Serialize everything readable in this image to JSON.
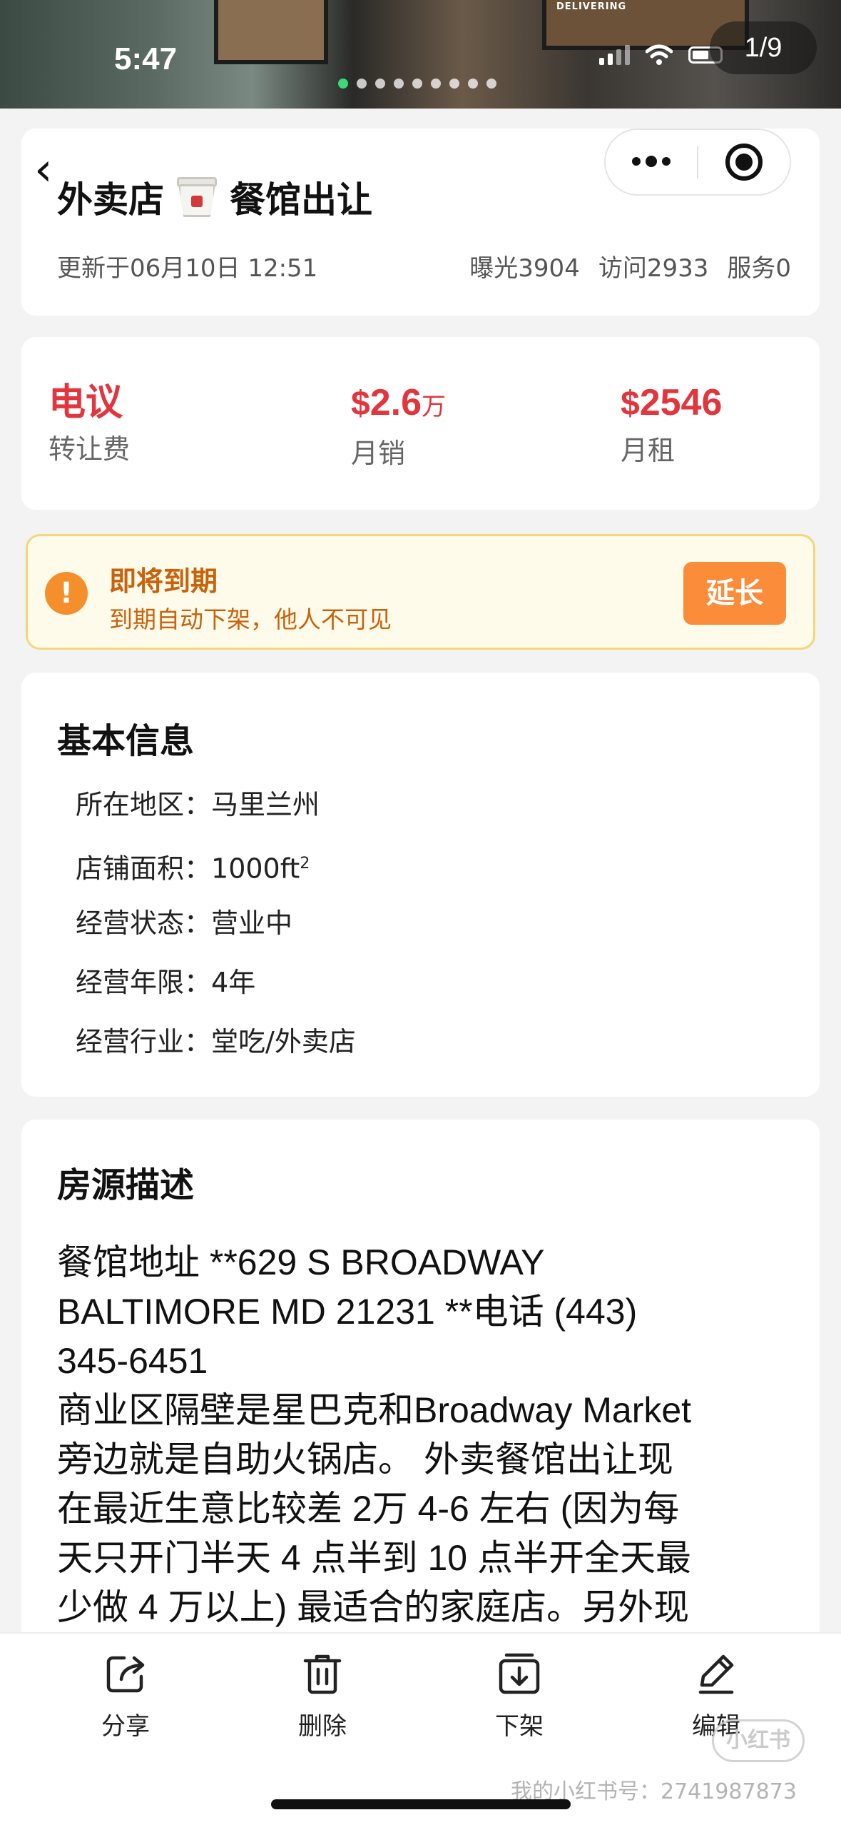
{
  "status_bar": {
    "time": "5:47"
  },
  "gallery": {
    "indicator": "1/9",
    "photo_text": "DELIVERING",
    "dots_total": 9,
    "active_dot": 0
  },
  "header": {
    "title_left": "外卖店",
    "title_right": "餐馆出让",
    "updated": "更新于06月10日 12:51",
    "stats": [
      "曝光3904",
      "访问2933",
      "服务0"
    ]
  },
  "prices": [
    {
      "value": "电议",
      "currency": "",
      "unit": "",
      "label": "转让费"
    },
    {
      "value": "2.6",
      "currency": "$",
      "unit": "万",
      "label": "月销"
    },
    {
      "value": "2546",
      "currency": "$",
      "unit": "",
      "label": "月租"
    }
  ],
  "expiry": {
    "icon": "!",
    "title": "即将到期",
    "subtitle": "到期自动下架，他人不可见",
    "button": "延长"
  },
  "basic_info": {
    "title": "基本信息",
    "rows": [
      {
        "label": "所在地区：",
        "value": "马里兰州"
      },
      {
        "label": "店铺面积：",
        "value": "1000ft",
        "sup": "2"
      },
      {
        "label": "经营状态：",
        "value": "营业中"
      },
      {
        "label": "经营年限：",
        "value": "4年"
      },
      {
        "label": "经营行业：",
        "value": "堂吃/外卖店"
      }
    ]
  },
  "description": {
    "title": "房源描述",
    "lines": [
      "餐馆地址 **629 S BROADWAY",
      "BALTIMORE MD 21231 **电话 (443)",
      "345-6451",
      "商业区隔壁是星巴克和Broadway Market",
      "旁边就是自助火锅店。 外卖餐馆出让现",
      "在最近生意比较差 2万 4-6 左右 (因为每",
      "天只开门半天 4 点半到 10 点半开全天最",
      "少做 4 万以上) 最适合的家庭店。另外现"
    ]
  },
  "actions": [
    {
      "label": "分享",
      "icon": "share-icon"
    },
    {
      "label": "删除",
      "icon": "trash-icon"
    },
    {
      "label": "下架",
      "icon": "unlist-icon"
    },
    {
      "label": "编辑",
      "icon": "edit-icon"
    }
  ],
  "watermark": {
    "logo": "小红书",
    "id": "我的小红书号：2741987873"
  }
}
